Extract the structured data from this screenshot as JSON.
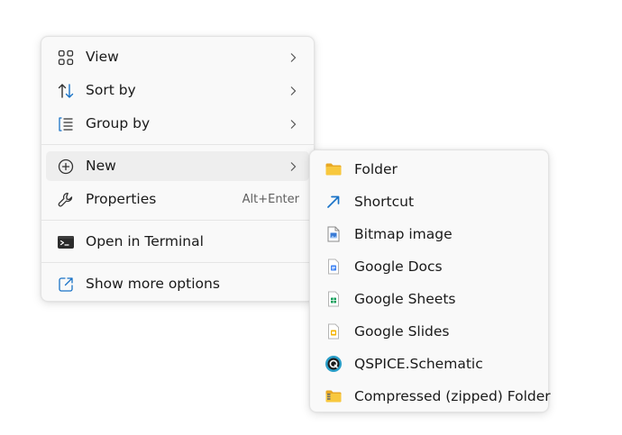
{
  "context_menu": {
    "items": [
      {
        "label": "View",
        "icon": "grid-icon",
        "has_submenu": true
      },
      {
        "label": "Sort by",
        "icon": "sort-arrows-icon",
        "has_submenu": true
      },
      {
        "label": "Group by",
        "icon": "list-group-icon",
        "has_submenu": true
      },
      {
        "label": "New",
        "icon": "plus-circle-icon",
        "has_submenu": true,
        "active": true
      },
      {
        "label": "Properties",
        "icon": "wrench-icon",
        "shortcut": "Alt+Enter"
      },
      {
        "label": "Open in Terminal",
        "icon": "terminal-icon"
      },
      {
        "label": "Show more options",
        "icon": "external-open-icon"
      }
    ]
  },
  "new_submenu": {
    "items": [
      {
        "label": "Folder",
        "icon": "folder-icon"
      },
      {
        "label": "Shortcut",
        "icon": "shortcut-arrow-icon"
      },
      {
        "label": "Bitmap image",
        "icon": "bitmap-file-icon"
      },
      {
        "label": "Google Docs",
        "icon": "google-docs-icon"
      },
      {
        "label": "Google Sheets",
        "icon": "google-sheets-icon"
      },
      {
        "label": "Google Slides",
        "icon": "google-slides-icon"
      },
      {
        "label": "QSPICE.Schematic",
        "icon": "qspice-icon"
      },
      {
        "label": "Compressed (zipped) Folder",
        "icon": "zip-folder-icon"
      }
    ]
  },
  "colors": {
    "menu_bg": "#f9f9f9",
    "hover_bg": "#eeeeee",
    "icon_blue": "#1a73c7",
    "folder_yellow": "#f8c33a",
    "docs_blue": "#4285f4",
    "sheets_green": "#0f9d58",
    "slides_yellow": "#f4b400",
    "qspice_teal": "#2a9fc9"
  }
}
